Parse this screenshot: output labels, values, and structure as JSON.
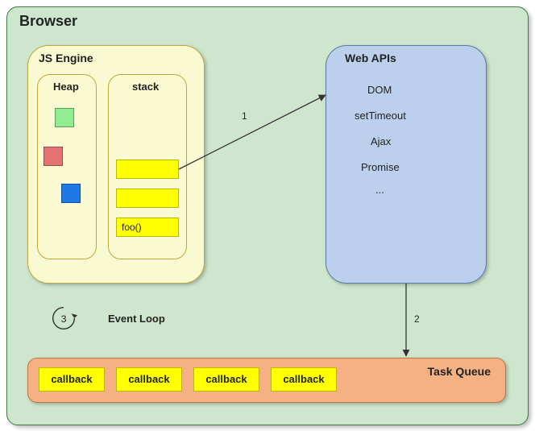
{
  "browser": {
    "title": "Browser"
  },
  "js_engine": {
    "title": "JS Engine",
    "heap": {
      "title": "Heap"
    },
    "stack": {
      "title": "stack",
      "cells": [
        "",
        "",
        "foo()"
      ]
    }
  },
  "web_apis": {
    "title": "Web APIs",
    "items": [
      "DOM",
      "setTimeout",
      "Ajax",
      "Promise",
      "..."
    ]
  },
  "task_queue": {
    "title": "Task Queue",
    "callbacks": [
      "callback",
      "callback",
      "callback",
      "callback"
    ]
  },
  "event_loop": {
    "label": "Event Loop",
    "num": "3"
  },
  "arrows": {
    "a1": "1",
    "a2": "2"
  }
}
